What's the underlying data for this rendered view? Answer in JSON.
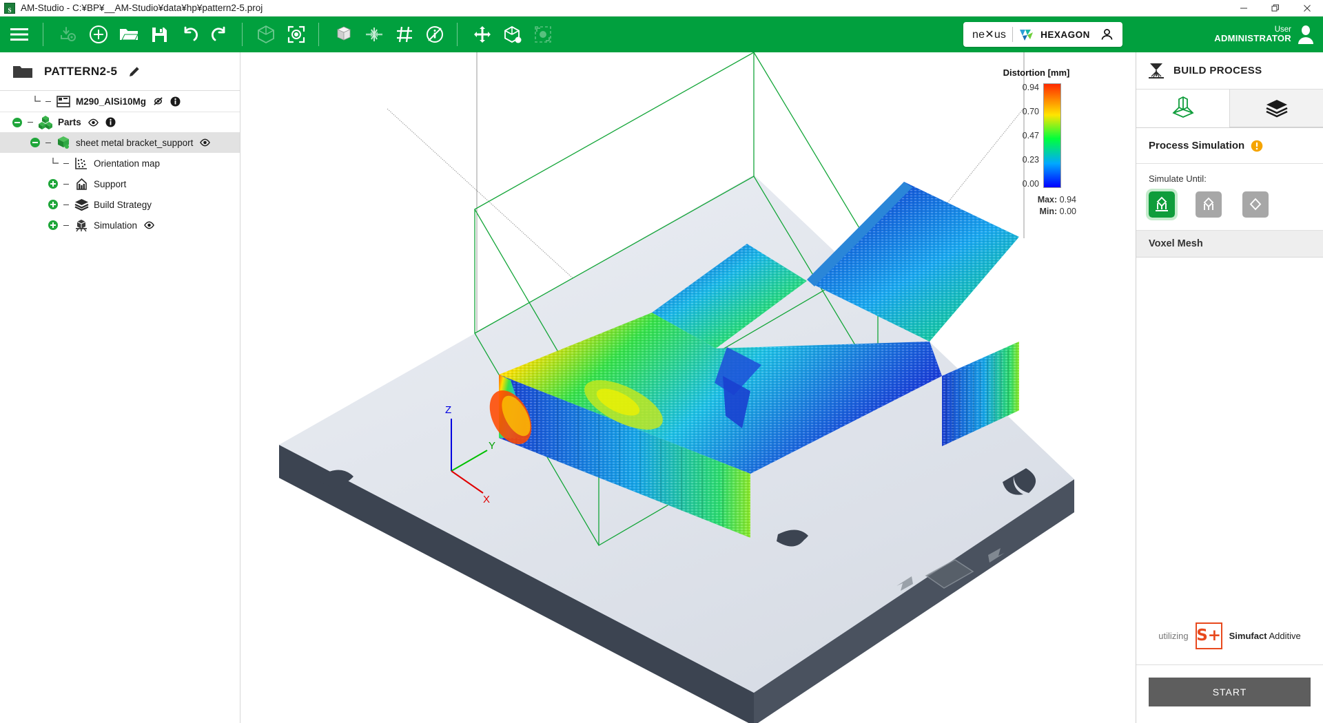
{
  "window": {
    "title": "AM-Studio - C:¥BP¥__AM-Studio¥data¥hp¥pattern2-5.proj",
    "app_icon": "am-studio-icon",
    "controls": {
      "minimize": "—",
      "restore": "❐",
      "close": "✕"
    }
  },
  "toolbar": {
    "accent_color": "#01a03e",
    "groups": [
      {
        "buttons": [
          {
            "icon": "hamburger-menu-icon",
            "enabled": true
          }
        ]
      },
      {
        "buttons": [
          {
            "icon": "import-download-icon",
            "enabled": false
          },
          {
            "icon": "new-plus-icon",
            "enabled": true
          },
          {
            "icon": "open-folder-icon",
            "enabled": true
          },
          {
            "icon": "save-disk-icon",
            "enabled": true
          },
          {
            "icon": "undo-icon",
            "enabled": true
          },
          {
            "icon": "redo-icon",
            "enabled": true
          }
        ]
      },
      {
        "buttons": [
          {
            "icon": "wireframe-cube-icon",
            "enabled": true
          },
          {
            "icon": "focus-target-icon",
            "enabled": true
          }
        ]
      },
      {
        "buttons": [
          {
            "icon": "solid-cube-icon",
            "enabled": true
          },
          {
            "icon": "mesh-repair-icon",
            "enabled": true
          },
          {
            "icon": "grid-slice-icon",
            "enabled": true
          },
          {
            "icon": "no-info-circle-icon",
            "enabled": true
          }
        ]
      },
      {
        "buttons": [
          {
            "icon": "move-arrows-icon",
            "enabled": true
          },
          {
            "icon": "place-part-icon",
            "enabled": true
          },
          {
            "icon": "scale-part-icon",
            "enabled": false
          }
        ]
      }
    ],
    "nexus_badge": {
      "nexus_label": "ne",
      "nexus_label_tail": "us",
      "hexagon_label": "HEXAGON",
      "account_icon": "account-person-icon"
    },
    "user": {
      "label": "User",
      "name": "ADMINISTRATOR",
      "icon": "user-avatar-icon"
    }
  },
  "sidebar": {
    "project": {
      "name": "PATTERN2-5",
      "folder_icon": "folder-icon",
      "edit_icon": "pencil-edit-icon"
    },
    "tree": [
      {
        "label": "M290_AlSi10Mg",
        "icon": "machine-icon",
        "indent": 1,
        "expander": "none",
        "bold": true,
        "selected": false,
        "badges": [
          {
            "icon": "hidden-eye-slash-icon"
          },
          {
            "icon": "info-circle-icon"
          }
        ]
      },
      {
        "label": "Parts",
        "icon": "parts-group-icon",
        "indent": 0,
        "expander": "minus",
        "bold": true,
        "selected": false,
        "badges": [
          {
            "icon": "visible-eye-icon"
          },
          {
            "icon": "info-circle-icon"
          }
        ]
      },
      {
        "label": "sheet metal bracket_support",
        "icon": "part-cube-icon",
        "indent": 1,
        "expander": "minus",
        "bold": false,
        "selected": true,
        "badges": [
          {
            "icon": "visible-eye-icon"
          }
        ]
      },
      {
        "label": "Orientation map",
        "icon": "orientation-map-icon",
        "indent": 2,
        "expander": "none",
        "bold": false,
        "selected": false,
        "badges": []
      },
      {
        "label": "Support",
        "icon": "support-icon",
        "indent": 2,
        "expander": "plus",
        "bold": false,
        "selected": false,
        "badges": []
      },
      {
        "label": "Build Strategy",
        "icon": "layers-stack-icon",
        "indent": 2,
        "expander": "plus",
        "bold": false,
        "selected": false,
        "badges": []
      },
      {
        "label": "Simulation",
        "icon": "simulation-icon",
        "indent": 2,
        "expander": "plus",
        "bold": false,
        "selected": false,
        "badges": [
          {
            "icon": "visible-eye-icon"
          }
        ]
      }
    ]
  },
  "viewport": {
    "axes": {
      "x": "X",
      "y": "Y",
      "z": "Z",
      "x_color": "#e00000",
      "y_color": "#00c000",
      "z_color": "#0000e0"
    },
    "bounding_box_color": "#13a538",
    "build_plate_color": "#414a55",
    "platform_color": "#dde1e8"
  },
  "legend": {
    "title": "Distortion [mm]",
    "ticks": [
      "0.94",
      "0.70",
      "0.47",
      "0.23",
      "0.00"
    ],
    "max_label": "Max:",
    "max_value": "0.94",
    "min_label": "Min:",
    "min_value": "0.00"
  },
  "chart_data": {
    "type": "heatmap",
    "title": "Distortion [mm]",
    "colormap": [
      "#0000ff",
      "#00a8ff",
      "#00ff3c",
      "#ffe500",
      "#ff2a00"
    ],
    "tick_values": [
      0.0,
      0.23,
      0.47,
      0.7,
      0.94
    ],
    "tick_labels": [
      "0.00",
      "0.23",
      "0.47",
      "0.70",
      "0.94"
    ],
    "range": [
      0.0,
      0.94
    ],
    "max": 0.94,
    "min": 0.0,
    "unit": "mm",
    "legend_position": "top-right",
    "grid": false
  },
  "right_panel": {
    "header": {
      "title": "BUILD PROCESS",
      "icon": "build-process-icon"
    },
    "tabs": [
      {
        "icon": "part-on-supports-icon",
        "active": true
      },
      {
        "icon": "layers-stack-icon",
        "active": false
      }
    ],
    "section": {
      "title": "Process Simulation",
      "status_icon": "warning-exclamation-icon",
      "status_color": "#f5a400"
    },
    "simulate_until": {
      "label": "Simulate Until:",
      "options": [
        {
          "icon": "part-supports-plate-icon",
          "active": true
        },
        {
          "icon": "part-supports-icon",
          "active": false
        },
        {
          "icon": "part-only-icon",
          "active": false
        }
      ]
    },
    "voxel_mesh": {
      "title": "Voxel Mesh"
    },
    "utilizing": {
      "prefix": "utilizing",
      "logo": "simufact-plus-logo",
      "logo_text": "S+",
      "brand_bold": "Simufact",
      "brand_rest": " Additive"
    },
    "start_button": {
      "label": "START"
    }
  }
}
